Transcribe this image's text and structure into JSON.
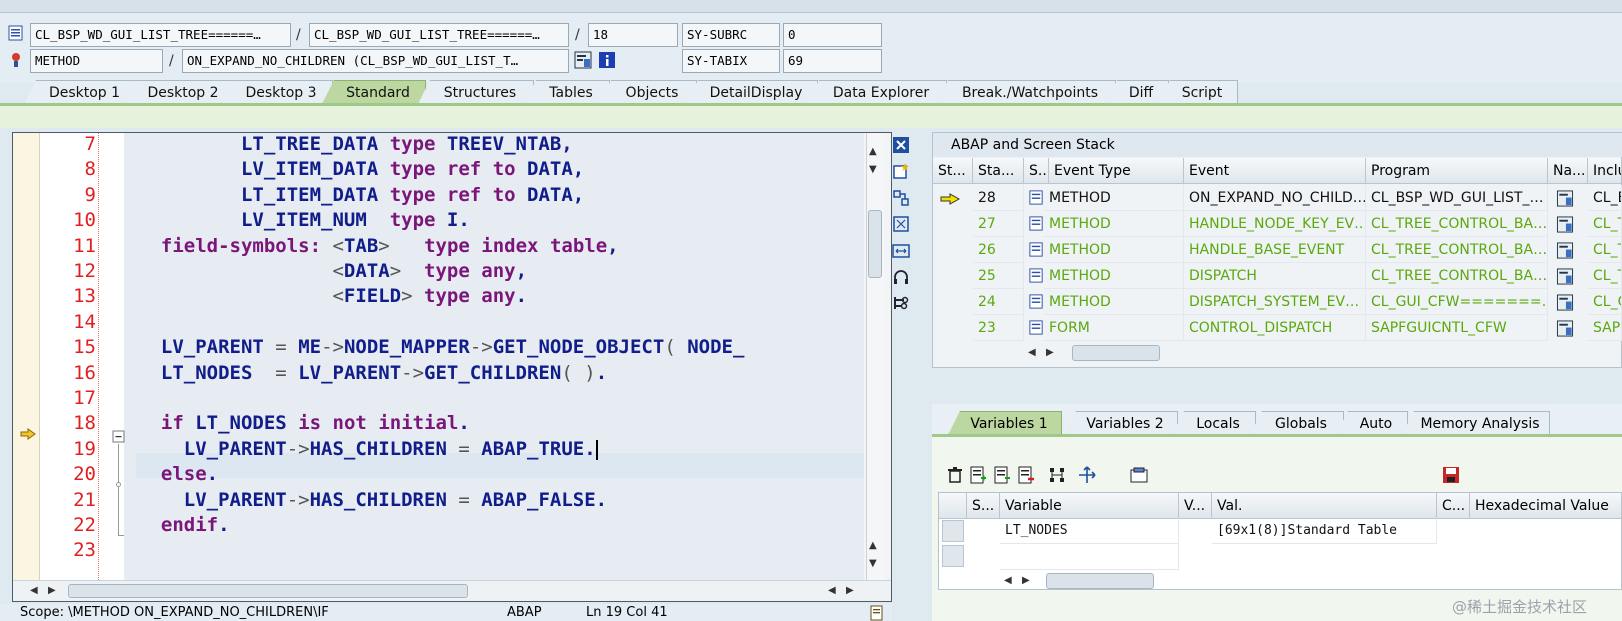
{
  "header": {
    "row1": {
      "field1": "CL_BSP_WD_GUI_LIST_TREE======…",
      "sep1": "/",
      "field2": "CL_BSP_WD_GUI_LIST_TREE======…",
      "sep2": "/",
      "field3": "18",
      "label": "SY-SUBRC",
      "value": "0"
    },
    "row2": {
      "field1": "METHOD",
      "sep1": "/",
      "field2": "ON_EXPAND_NO_CHILDREN (CL_BSP_WD_GUI_LIST_T…",
      "label": "SY-TABIX",
      "value": "69"
    }
  },
  "tabs": [
    "Desktop 1",
    "Desktop 2",
    "Desktop 3",
    "Standard",
    "Structures",
    "Tables",
    "Objects",
    "DetailDisplay",
    "Data Explorer",
    "Break./Watchpoints",
    "Diff",
    "Script"
  ],
  "active_tab": "Standard",
  "editor": {
    "line_numbers": [
      "7",
      "8",
      "9",
      "10",
      "11",
      "12",
      "13",
      "14",
      "15",
      "16",
      "17",
      "18",
      "19",
      "20",
      "21",
      "22",
      "23"
    ],
    "current_line": "19"
  },
  "status": {
    "scope": "Scope: \\METHOD ON_EXPAND_NO_CHILDREN\\IF",
    "lang": "ABAP",
    "position": "Ln 19 Col 41"
  },
  "stack": {
    "title": "ABAP and Screen Stack",
    "headers": [
      "St...",
      "Sta...",
      "S..",
      "Event Type",
      "Event",
      "Program",
      "Na...",
      "Inclu"
    ],
    "rows": [
      {
        "level": "28",
        "type": "METHOD",
        "event": "ON_EXPAND_NO_CHILD…",
        "program": "CL_BSP_WD_GUI_LIST_…",
        "include": "CL_B"
      },
      {
        "level": "27",
        "type": "METHOD",
        "event": "HANDLE_NODE_KEY_EV…",
        "program": "CL_TREE_CONTROL_BA…",
        "include": "CL_T"
      },
      {
        "level": "26",
        "type": "METHOD",
        "event": "HANDLE_BASE_EVENT",
        "program": "CL_TREE_CONTROL_BA…",
        "include": "CL_T"
      },
      {
        "level": "25",
        "type": "METHOD",
        "event": "DISPATCH",
        "program": "CL_TREE_CONTROL_BA…",
        "include": "CL_T"
      },
      {
        "level": "24",
        "type": "METHOD",
        "event": "DISPATCH_SYSTEM_EV…",
        "program": "CL_GUI_CFW=======…",
        "include": "CL_G"
      },
      {
        "level": "23",
        "type": "FORM",
        "event": "CONTROL_DISPATCH",
        "program": "SAPFGUICNTL_CFW",
        "include": "SAPF"
      }
    ]
  },
  "var_tabs": [
    "Variables 1",
    "Variables 2",
    "Locals",
    "Globals",
    "Auto",
    "Memory Analysis"
  ],
  "variables": {
    "headers": [
      "S...",
      "Variable",
      "V...",
      "Val.",
      "C...",
      "Hexadecimal Value"
    ],
    "rows": [
      {
        "variable": "LT_NODES",
        "value": "[69x1(8)]Standard Table"
      }
    ]
  },
  "watermark": "@稀土掘金技术社区",
  "colors": {
    "keyword": "#7a167a",
    "identifier": "#101d8a",
    "line_number": "#e02020",
    "active_tab": "#bcd8a0",
    "stack_text": "#5aa80e"
  }
}
